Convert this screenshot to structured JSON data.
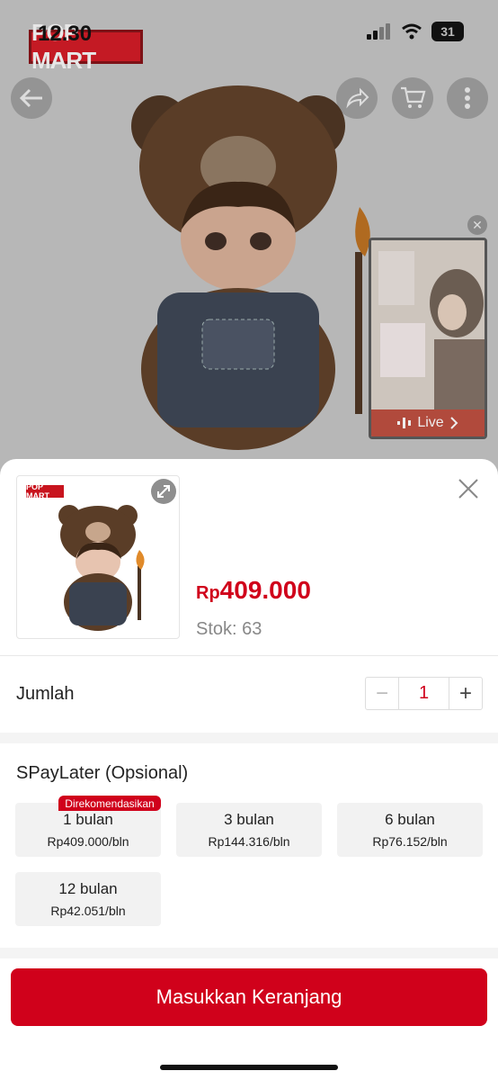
{
  "status_bar": {
    "time": "12.30",
    "battery": "31"
  },
  "header": {
    "brand_logo": "POP MART",
    "icons": [
      "back-arrow-icon",
      "share-icon",
      "cart-icon",
      "more-icon"
    ]
  },
  "live": {
    "label": "Live"
  },
  "product": {
    "thumb_logo": "POP MART",
    "currency": "Rp",
    "price": "409.000",
    "stock": "Stok: 63"
  },
  "quantity": {
    "label": "Jumlah",
    "value": "1",
    "minus": "−",
    "plus": "+"
  },
  "spaylater": {
    "label": "SPayLater (Opsional)",
    "badge": "Direkomendasikan",
    "plans": [
      {
        "term": "1 bulan",
        "price": "Rp409.000/bln"
      },
      {
        "term": "3 bulan",
        "price": "Rp144.316/bln"
      },
      {
        "term": "6 bulan",
        "price": "Rp76.152/bln"
      },
      {
        "term": "12 bulan",
        "price": "Rp42.051/bln"
      }
    ]
  },
  "cta": {
    "label": "Masukkan Keranjang"
  },
  "colors": {
    "accent": "#d0011b",
    "overlay": "#b7b7b7"
  }
}
